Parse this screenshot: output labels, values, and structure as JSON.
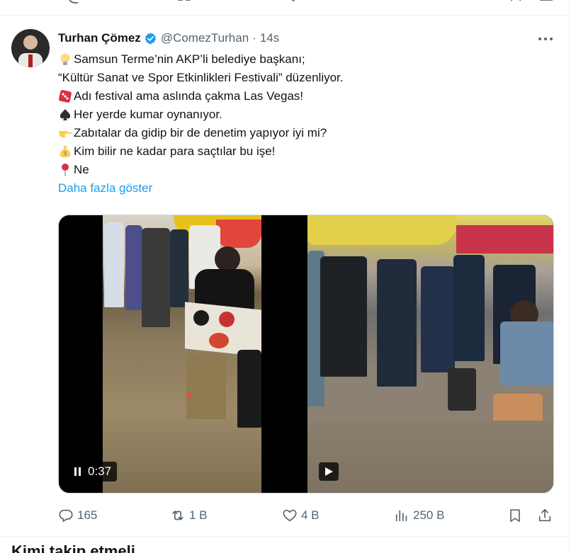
{
  "tweet": {
    "author_name": "Turhan Çömez",
    "handle": "@ComezTurhan",
    "separator": "·",
    "time": "14s",
    "lines": [
      {
        "emoji": "light-bulb",
        "text": "Samsun Terme’nin AKP’li belediye başkanı;"
      },
      {
        "emoji": "",
        "text": "“Kültür Sanat ve Spor Etkinlikleri Festivali” düzenliyor."
      },
      {
        "emoji": "game-die",
        "text": "Adı festival ama aslında çakma Las Vegas!"
      },
      {
        "emoji": "spade-suit",
        "text": "Her yerde kumar oynanıyor."
      },
      {
        "emoji": "backhand-index-pointing-right",
        "text": "Zabıtalar da gidip bir de denetim yapıyor iyi mi?"
      },
      {
        "emoji": "money-bag",
        "text": "Kim bilir ne kadar para saçtılar bu işe!"
      },
      {
        "emoji": "round-pushpin",
        "text": "Ne"
      }
    ],
    "show_more": "Daha fazla göster",
    "media": {
      "video1_duration": "0:37",
      "video1_state": "playing",
      "video2_state": "paused"
    },
    "stats": {
      "replies": "165",
      "reposts": "1 B",
      "likes": "4 B",
      "views": "250 B"
    }
  },
  "next_section_heading": "Kimi takip etmeli",
  "colors": {
    "text": "#0f1419",
    "secondary": "#536471",
    "link": "#1d9bf0",
    "border": "#eff3f4",
    "verified": "#1d9bf0"
  }
}
